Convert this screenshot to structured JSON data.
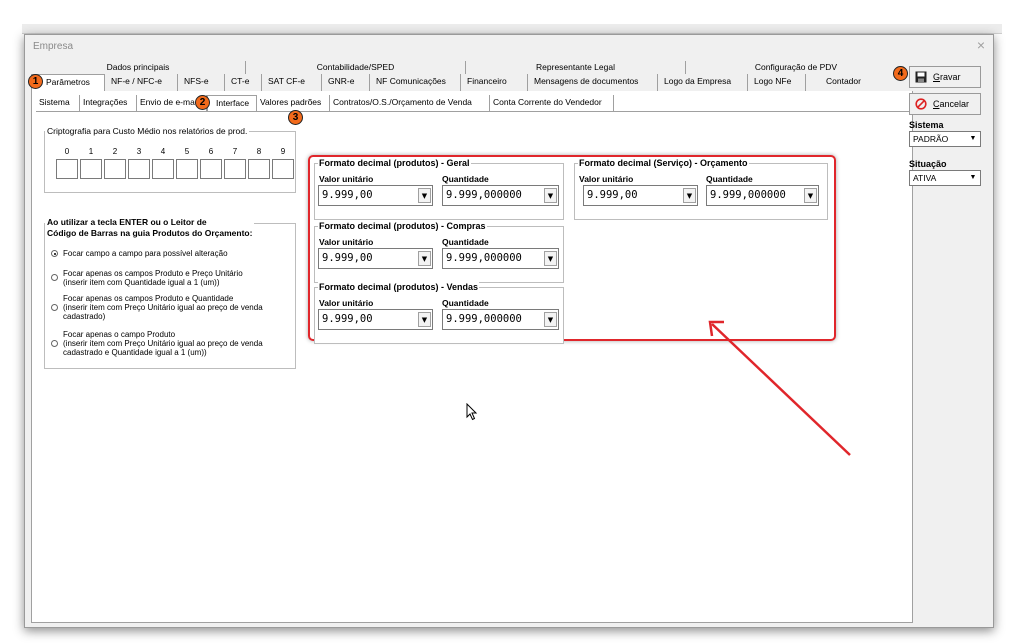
{
  "window": {
    "title": "Empresa",
    "close": "×"
  },
  "top_tabs_row1": [
    "Dados principais",
    "Contabilidade/SPED",
    "Representante Legal",
    "Configuração de PDV"
  ],
  "top_tabs_row2": [
    "Parâmetros",
    "NF-e / NFC-e",
    "NFS-e",
    "CT-e",
    "SAT CF-e",
    "GNR-e",
    "NF Comunicações",
    "Financeiro",
    "Mensagens de documentos",
    "Logo da Empresa",
    "Logo NFe",
    "Contador"
  ],
  "sub_tabs": [
    "Sistema",
    "Integrações",
    "Envio de e-ma",
    "Interface",
    "Valores padrões",
    "Contratos/O.S./Orçamento de Venda",
    "Conta Corrente do Vendedor"
  ],
  "cripto": {
    "legend": "Criptografia para Custo Médio nos relatórios de prod.",
    "digits": [
      "0",
      "1",
      "2",
      "3",
      "4",
      "5",
      "6",
      "7",
      "8",
      "9"
    ]
  },
  "enter_group": {
    "legend_line1": "Ao utilizar a tecla ENTER ou o Leitor de",
    "legend_line2": "Código de Barras na guia Produtos do Orçamento:",
    "options": [
      {
        "lines": [
          "Focar campo a campo para possível alteração"
        ],
        "selected": true
      },
      {
        "lines": [
          "Focar apenas os campos Produto e Preço Unitário",
          "(inserir item com Quantidade igual a 1 (um))"
        ],
        "selected": false
      },
      {
        "lines": [
          "Focar apenas os campos Produto e Quantidade",
          "(inserir item com Preço Unitário igual ao preço de venda",
          "cadastrado)"
        ],
        "selected": false
      },
      {
        "lines": [
          "Focar apenas o campo Produto",
          "(inserir item com Preço Unitário igual ao preço de venda",
          "cadastrado e Quantidade igual a 1 (um))"
        ],
        "selected": false
      }
    ]
  },
  "formats": {
    "geral": {
      "title": "Formato decimal (produtos) - Geral",
      "valor_label": "Valor unitário",
      "valor": "9.999,00",
      "qtd_label": "Quantidade",
      "qtd": "9.999,000000"
    },
    "servico": {
      "title": "Formato decimal (Serviço) - Orçamento",
      "valor_label": "Valor unitário",
      "valor": "9.999,00",
      "qtd_label": "Quantidade",
      "qtd": "9.999,000000"
    },
    "compras": {
      "title": "Formato decimal (produtos) - Compras",
      "valor_label": "Valor unitário",
      "valor": "9.999,00",
      "qtd_label": "Quantidade",
      "qtd": "9.999,000000"
    },
    "vendas": {
      "title": "Formato decimal (produtos) - Vendas",
      "valor_label": "Valor unitário",
      "valor": "9.999,00",
      "qtd_label": "Quantidade",
      "qtd": "9.999,000000"
    }
  },
  "side": {
    "gravar_rest": "ravar",
    "gravar_key": "G",
    "cancelar_rest": "ancelar",
    "cancelar_key": "C",
    "sistema_label": "Sistema",
    "sistema_value": "PADRÃO",
    "situacao_label": "Situação",
    "situacao_value": "ATIVA"
  },
  "badges": [
    "1",
    "2",
    "3",
    "4"
  ],
  "colors": {
    "highlight": "#e0262b",
    "badge": "#f26a1b"
  }
}
